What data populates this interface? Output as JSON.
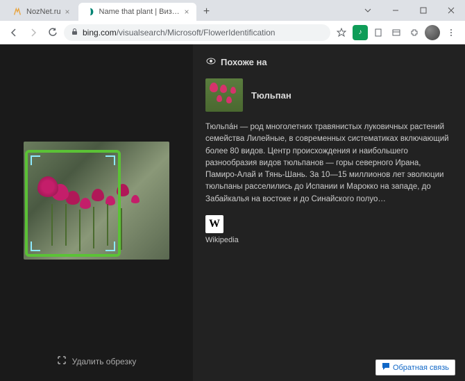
{
  "tabs": [
    {
      "label": "NozNet.ru"
    },
    {
      "label": "Name that plant | Визуальный п"
    }
  ],
  "url": {
    "domain": "bing.com",
    "path": "/visualsearch/Microsoft/FlowerIdentification"
  },
  "left": {
    "delete_crop": "Удалить обрезку"
  },
  "right": {
    "section": "Похоже на",
    "result_title": "Тюльпан",
    "description": "Тюльпа́н — род многолетних травянистых луковичных растений семейства Лилейные, в современных систематиках включающий более 80 видов. Центр происхождения и наибольшего разнообразия видов тюльпанов — горы северного Ирана, Памиро-Алай и Тянь-Шань. За 10—15 миллионов лет эволюции тюльпаны расселились до Испании и Марокко на западе, до Забайкалья на востоке и до Синайского полуо…",
    "source_letter": "W",
    "source_name": "Wikipedia"
  },
  "feedback": "Обратная связь"
}
